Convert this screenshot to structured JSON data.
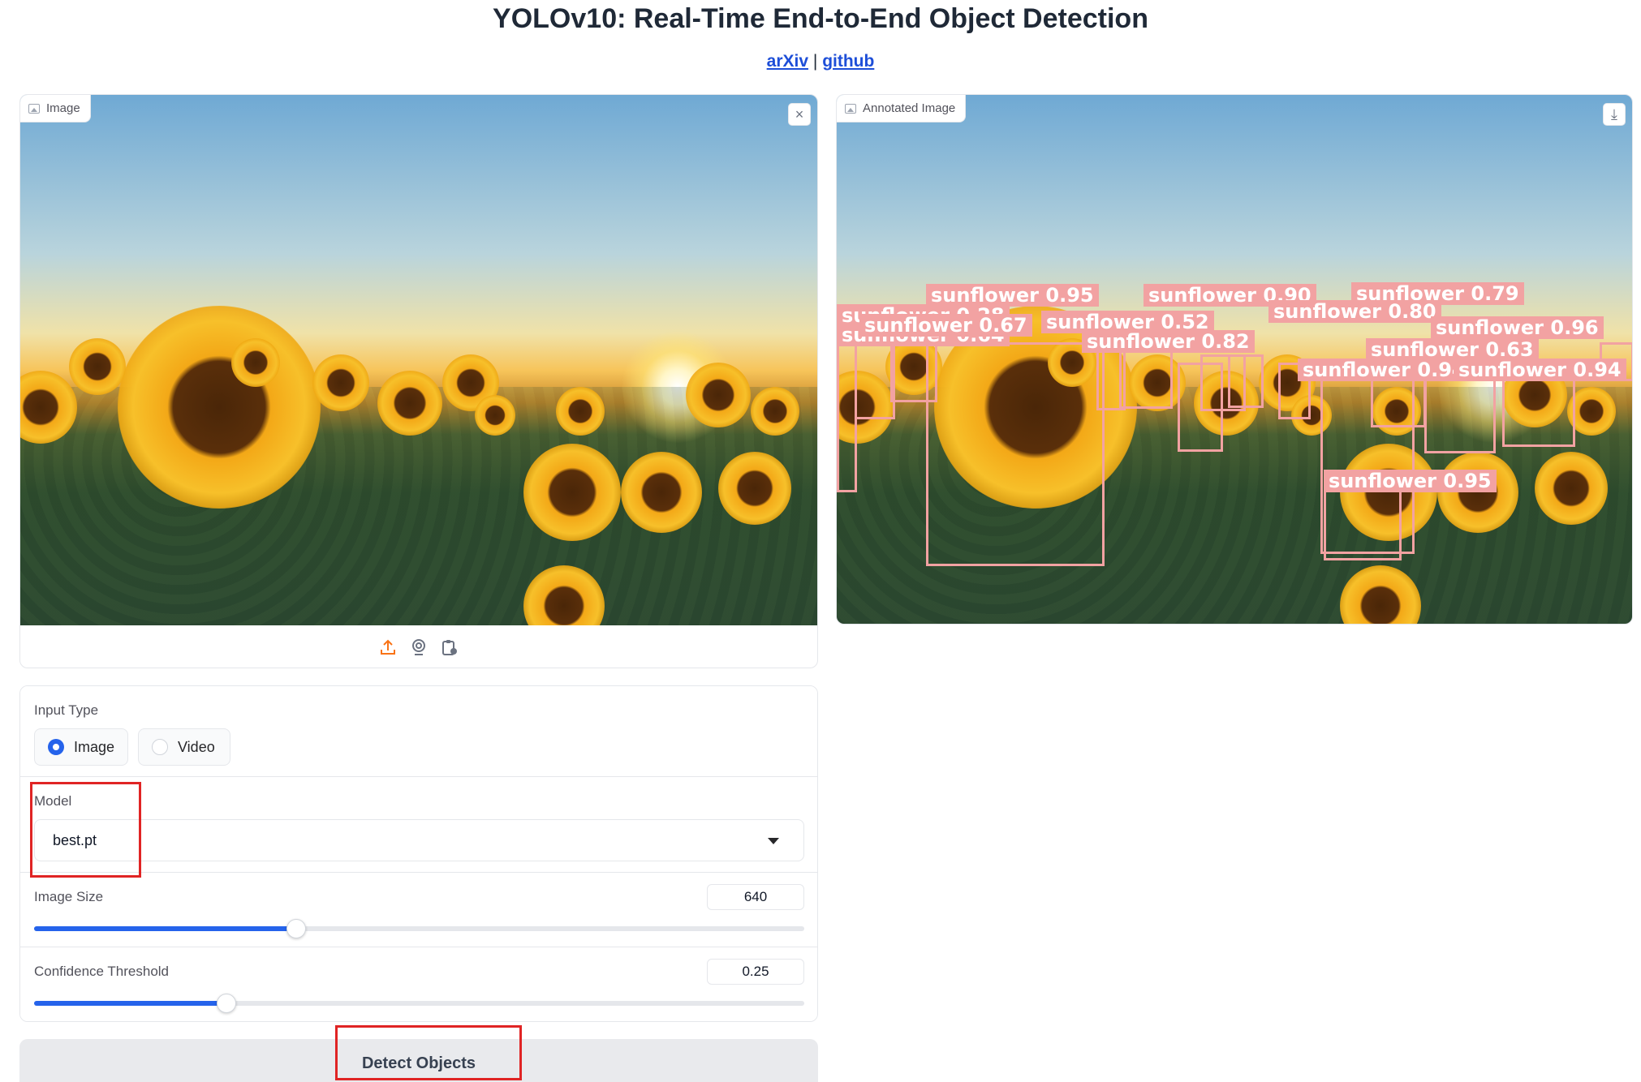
{
  "page": {
    "title": "YOLOv10: Real-Time End-to-End Object Detection",
    "links": [
      {
        "label": "arXiv"
      },
      {
        "label": "github"
      }
    ],
    "link_separator": "|"
  },
  "input_panel": {
    "label": "Image",
    "label_icon": "image-icon",
    "close_icon": "close-icon",
    "close_glyph": "×",
    "source_tools": [
      {
        "name": "upload-icon"
      },
      {
        "name": "webcam-icon"
      },
      {
        "name": "clipboard-icon"
      }
    ]
  },
  "output_panel": {
    "label": "Annotated Image",
    "label_icon": "image-icon",
    "download_icon": "download-icon",
    "download_glyph": "⤓",
    "detections": [
      {
        "text": "sunflower 0.95"
      },
      {
        "text": "sunflower 0.90"
      },
      {
        "text": "sunflower 0.79"
      },
      {
        "text": "sunflower 0.80"
      },
      {
        "text": "sunflower 0.67"
      },
      {
        "text": "sunflower 0.52"
      },
      {
        "text": "sunflower 0.82"
      },
      {
        "text": "sunflower 0.96"
      },
      {
        "text": "sunflower 0.63"
      },
      {
        "text": "sunflower 0.94"
      },
      {
        "text": "sunflower 0.94"
      },
      {
        "text": "sunflower 0.95"
      }
    ]
  },
  "form": {
    "input_type": {
      "label": "Input Type",
      "options": [
        "Image",
        "Video"
      ],
      "selected": "Image"
    },
    "model": {
      "label": "Model",
      "value": "best.pt"
    },
    "image_size": {
      "label": "Image Size",
      "value": "640",
      "fraction": 0.34
    },
    "confidence": {
      "label": "Confidence Threshold",
      "value": "0.25",
      "fraction": 0.25
    }
  },
  "detect_button": {
    "label": "Detect Objects"
  },
  "colors": {
    "accent": "#2563eb",
    "detection_box": "#f2a2a2",
    "highlight": "#e02424",
    "upload_icon": "#f97316"
  }
}
